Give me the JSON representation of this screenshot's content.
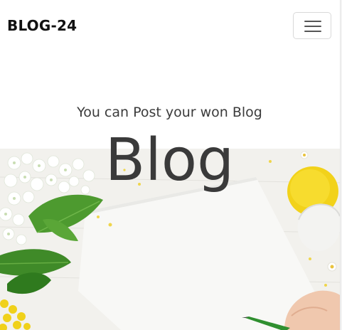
{
  "navbar": {
    "brand": "BLOG-24",
    "toggler_icon": "hamburger-menu-icon"
  },
  "hero": {
    "subtitle": "You can Post your won Blog",
    "title": "Blog",
    "image": "flowers-paper-pencil-photo"
  },
  "colors": {
    "text": "#3a3a3a",
    "brand_text": "#111111",
    "toggler_border": "#d9d9d9"
  }
}
